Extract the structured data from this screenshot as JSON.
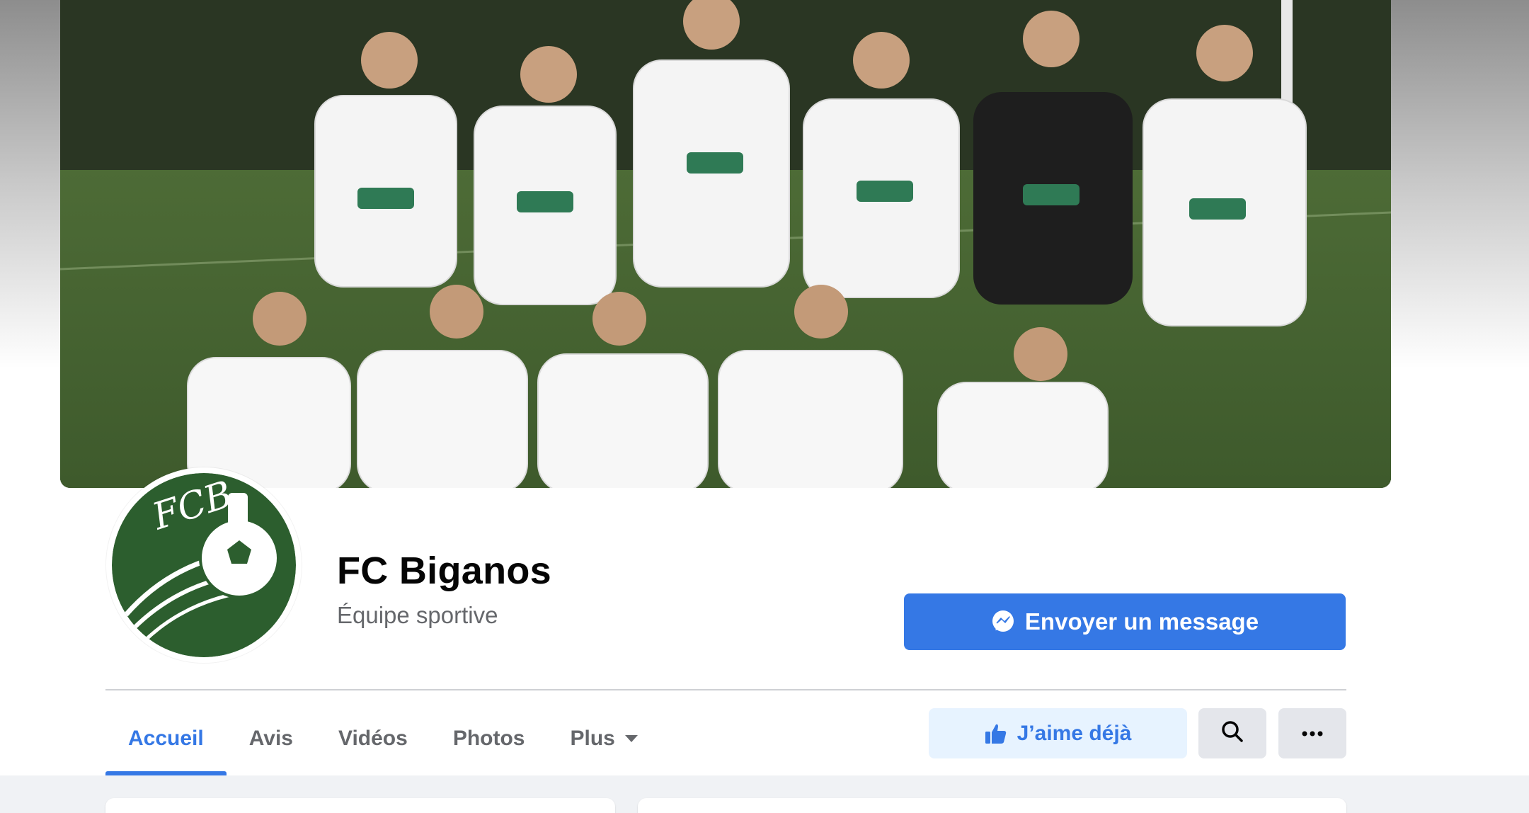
{
  "page": {
    "name": "FC Biganos",
    "category": "Équipe sportive"
  },
  "avatar": {
    "logo_text": "FCB"
  },
  "actions": {
    "message_label": "Envoyer un message",
    "like_label": "J’aime déjà"
  },
  "tabs": [
    {
      "label": "Accueil",
      "active": true
    },
    {
      "label": "Avis",
      "active": false
    },
    {
      "label": "Vidéos",
      "active": false
    },
    {
      "label": "Photos",
      "active": false
    },
    {
      "label": "Plus",
      "active": false,
      "has_dropdown": true
    }
  ],
  "icons": {
    "message": "messenger-icon",
    "like": "thumbs-up-icon",
    "search": "search-icon",
    "more": "more-dots-icon",
    "dropdown": "caret-down-icon"
  },
  "colors": {
    "accent": "#3578e5",
    "like_bg": "#e7f3ff",
    "grey_button": "#e4e6eb",
    "logo_green": "#2c5e2e"
  }
}
